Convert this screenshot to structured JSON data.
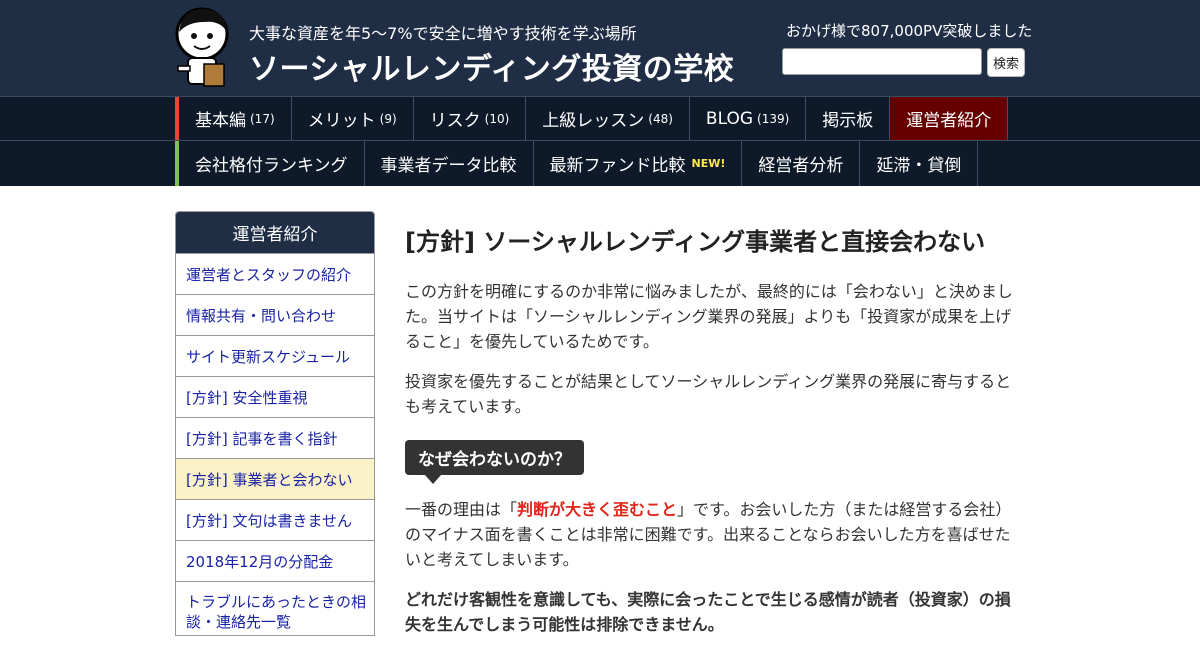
{
  "header": {
    "tagline": "大事な資産を年5～7%で安全に増やす技術を学ぶ場所",
    "site_title": "ソーシャルレンディング投資の学校",
    "pv_text": "おかげ様で807,000PV突破しました",
    "search_button": "検索",
    "search_value": ""
  },
  "nav_primary": [
    {
      "label": "基本編",
      "count": "(17)"
    },
    {
      "label": "メリット",
      "count": "(9)"
    },
    {
      "label": "リスク",
      "count": "(10)"
    },
    {
      "label": "上級レッスン",
      "count": "(48)"
    },
    {
      "label": "BLOG",
      "count": "(139)"
    },
    {
      "label": "掲示板",
      "count": ""
    },
    {
      "label": "運営者紹介",
      "count": ""
    }
  ],
  "nav_secondary": [
    {
      "label": "会社格付ランキング",
      "badge": ""
    },
    {
      "label": "事業者データ比較",
      "badge": ""
    },
    {
      "label": "最新ファンド比較",
      "badge": "NEW!"
    },
    {
      "label": "経営者分析",
      "badge": ""
    },
    {
      "label": "延滞・貸倒",
      "badge": ""
    }
  ],
  "sidebar": {
    "title": "運営者紹介",
    "items": [
      "運営者とスタッフの紹介",
      "情報共有・問い合わせ",
      "サイト更新スケジュール",
      "[方針] 安全性重視",
      "[方針] 記事を書く指針",
      "[方針] 事業者と会わない",
      "[方針] 文句は書きません",
      "2018年12月の分配金",
      "トラブルにあったときの相談・連絡先一覧"
    ]
  },
  "article": {
    "title": "[方針] ソーシャルレンディング事業者と直接会わない",
    "p1": "この方針を明確にするのか非常に悩みましたが、最終的には「会わない」と決めました。当サイトは「ソーシャルレンディング業界の発展」よりも「投資家が成果を上げること」を優先しているためです。",
    "p2": "投資家を優先することが結果としてソーシャルレンディング業界の発展に寄与するとも考えています。",
    "h2": "なぜ会わないのか？",
    "p3_before": "一番の理由は「",
    "p3_em": "判断が大きく歪むこと",
    "p3_after": "」です。お会いした方（または経営する会社）のマイナス面を書くことは非常に困難です。出来ることならお会いした方を喜ばせたいと考えてしまいます。",
    "p4": "どれだけ客観性を意識しても、実際に会ったことで生じる感情が読者（投資家）の損失を生んでしまう可能性は排除できません。"
  }
}
